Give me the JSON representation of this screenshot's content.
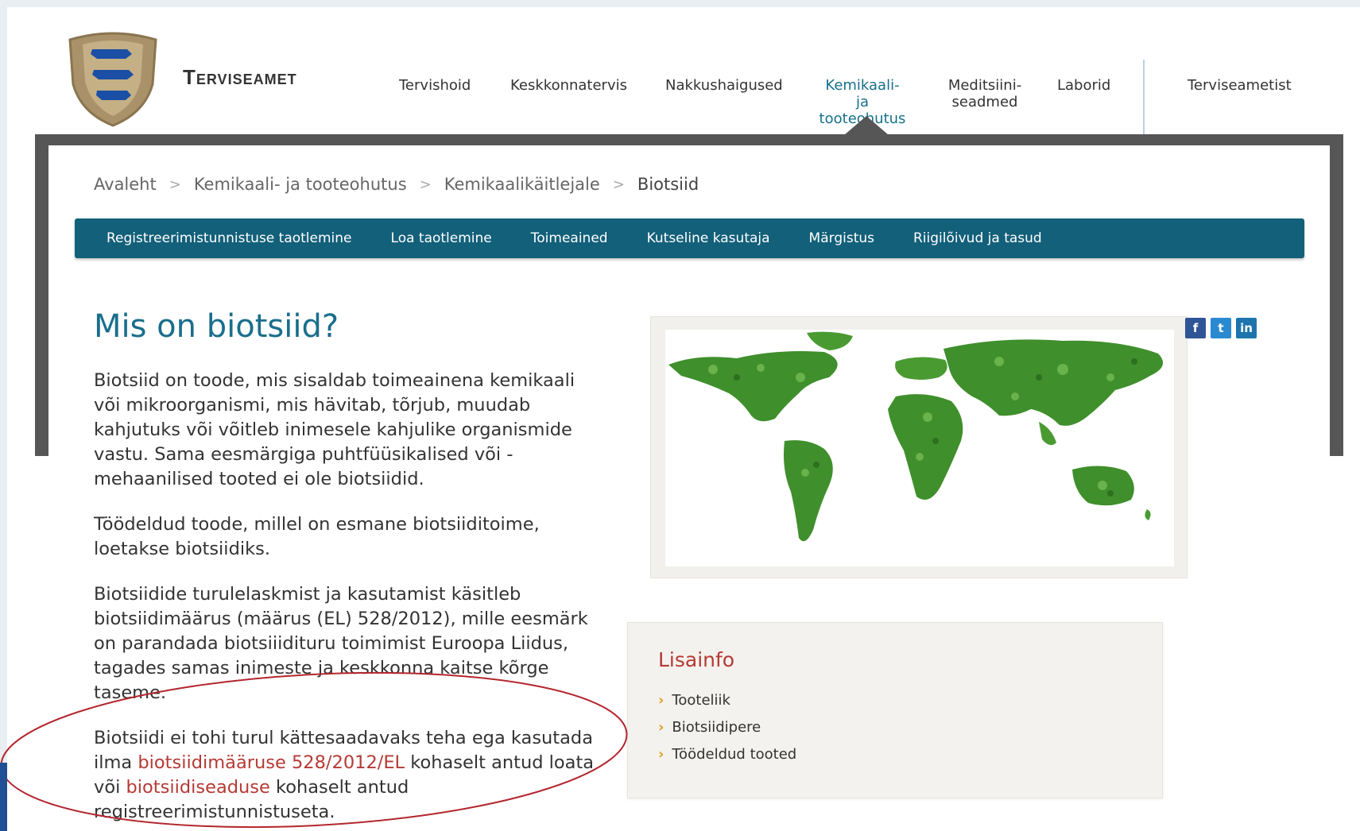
{
  "site": {
    "name": "Terviseamet"
  },
  "topnav": [
    {
      "label": "Tervishoid"
    },
    {
      "label": "Keskkonnatervis"
    },
    {
      "label": "Nakkushaigused"
    },
    {
      "label": "Kemikaali- ja tooteohutus",
      "lines": [
        "Kemikaali-",
        "ja",
        "tooteohutus"
      ],
      "active": true
    },
    {
      "label": "Meditsiini-seadmed",
      "lines": [
        "Meditsiini-",
        "seadmed"
      ]
    },
    {
      "label": "Laborid"
    },
    {
      "label": "Terviseametist"
    }
  ],
  "breadcrumb": [
    "Avaleht",
    "Kemikaali- ja tooteohutus",
    "Kemikaalikäitlejale",
    "Biotsiid"
  ],
  "subnav": [
    "Registreerimistunnistuse taotlemine",
    "Loa taotlemine",
    "Toimeained",
    "Kutseline kasutaja",
    "Märgistus",
    "Riigilõivud ja tasud"
  ],
  "main": {
    "title": "Mis on biotsiid?",
    "p1": "Biotsiid on  toode, mis sisaldab toimeainena kemikaali või mikroorganismi, mis hävitab, tõrjub, muudab kahjutuks või võitleb inimesele kahjulike organismide vastu.  Sama eesmärgiga puhtfüüsikalised või -mehaanilised tooted ei ole biotsiidid.",
    "p2": "Töödeldud toode, millel on esmane biotsiiditoime, loetakse biotsiidiks.",
    "p3": "Biotsiidide turulelaskmist ja kasutamist käsitleb biotsiidimäärus (määrus (EL) 528/2012), mille eesmärk on parandada biotsiiidituru toimimist Euroopa Liidus, tagades samas inimeste ja keskkonna kaitse kõrge taseme.",
    "p4_pre": "Biotsiidi ei tohi turul kättesaadavaks teha ega kasutada ilma ",
    "p4_link1": "biotsiidimääruse 528/2012/EL",
    "p4_mid": " kohaselt antud loata või ",
    "p4_link2": "biotsiidiseaduse",
    "p4_post": " kohaselt antud registreerimistunnistuseta."
  },
  "share": {
    "facebook": "f",
    "twitter": "t",
    "linkedin": "in"
  },
  "sidebar": {
    "title": "Lisainfo",
    "links": [
      "Tooteliik",
      "Biotsiidipere",
      "Töödeldud tooted"
    ]
  },
  "colors": {
    "accent": "#13607a",
    "title": "#1a6e8c",
    "link": "#b53a35",
    "bullet": "#e0a020"
  }
}
